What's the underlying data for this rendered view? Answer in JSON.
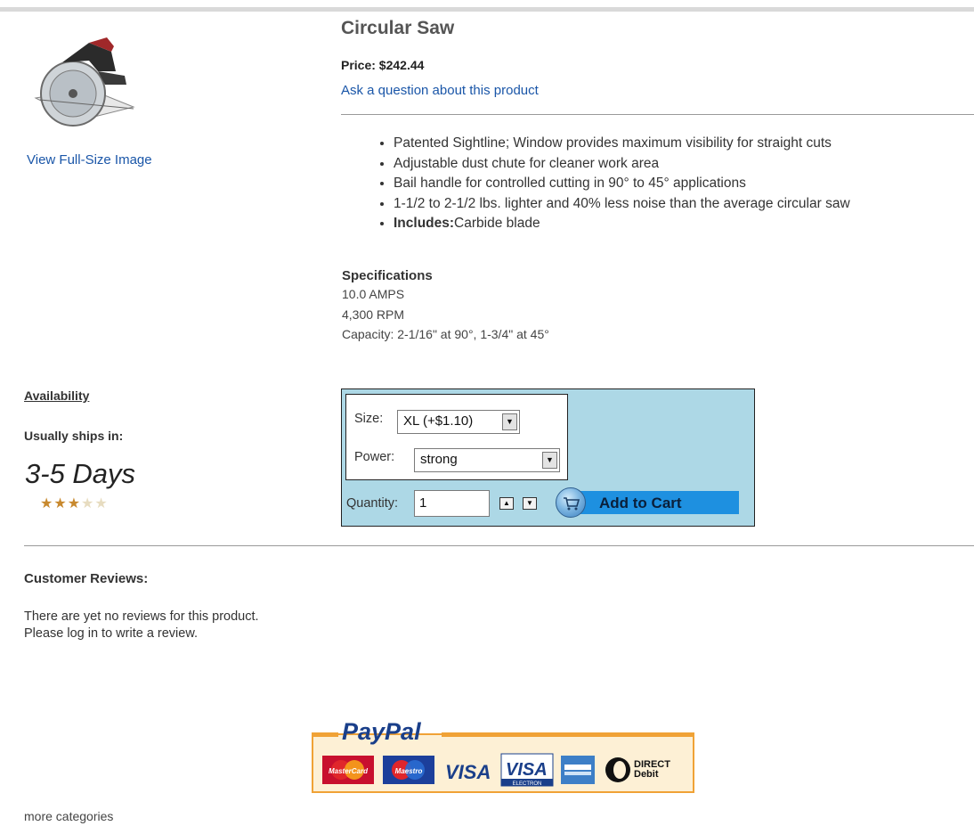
{
  "product": {
    "title": "Circular Saw",
    "price": "Price: $242.44",
    "ask_link": "Ask a question about this product",
    "view_full_image": "View Full-Size Image"
  },
  "features": [
    {
      "text": "Patented Sightline; Window provides maximum visibility for straight cuts"
    },
    {
      "text": "Adjustable dust chute for cleaner work area"
    },
    {
      "text": "Bail handle for controlled cutting in 90° to 45° applications"
    },
    {
      "text": "1-1/2 to 2-1/2 lbs. lighter and 40% less noise than the average circular saw"
    },
    {
      "bold": "Includes:",
      "text": "Carbide blade"
    }
  ],
  "specifications": {
    "heading": "Specifications",
    "lines": [
      "10.0 AMPS",
      "4,300 RPM",
      "Capacity: 2-1/16\" at 90°, 1-3/4\" at 45°"
    ]
  },
  "availability": {
    "heading": "Availability",
    "ships_label": "Usually ships in:",
    "days": "3-5 Days",
    "rating_stars": 3,
    "rating_max": 5
  },
  "cart": {
    "size_label": "Size:",
    "size_value": "XL (+$1.10)",
    "power_label": "Power:",
    "power_value": "strong",
    "quantity_label": "Quantity:",
    "quantity_value": "1",
    "add_to_cart": "Add to Cart"
  },
  "reviews": {
    "heading": "Customer Reviews:",
    "line1": "There are yet no reviews for this product.",
    "line2": "Please log in to write a review."
  },
  "payment": {
    "brand": "PayPal",
    "cards": [
      "MasterCard",
      "Maestro",
      "VISA",
      "VISA",
      "",
      "DIRECT Debit"
    ],
    "visa_electron_sub": "ELECTRON"
  },
  "footer": {
    "more_categories": "more categories"
  },
  "colors": {
    "link": "#1a56a8",
    "cart_box": "#add8e6",
    "add_to_cart_bar": "#1e90e0",
    "star_on": "#c8892e",
    "paypal_orange": "#f0a236"
  }
}
